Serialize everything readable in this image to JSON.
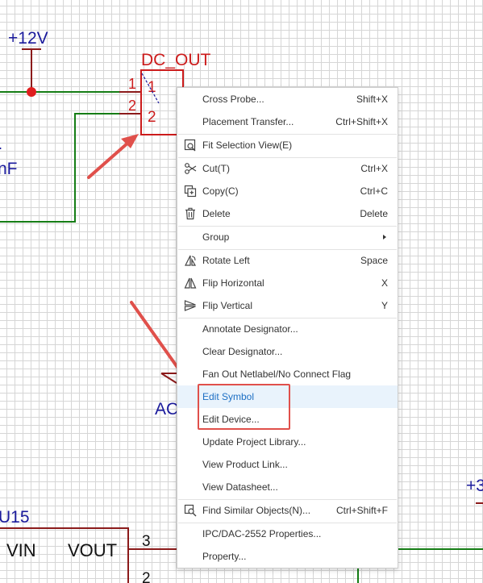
{
  "schematic": {
    "power_12v": "+12V",
    "power_3v": "+3",
    "connector_name": "DC_OUT",
    "connector_pin1": "1",
    "connector_pin2": "2",
    "pin_num_1": "1",
    "pin_num_2": "2",
    "cap_value": "nF",
    "cap_dot": ".",
    "net_label": "AC",
    "u15_name": "U15",
    "u15_vin": "VIN",
    "u15_vout": "VOUT",
    "u15_pin3": "3",
    "u15_pin2": "2"
  },
  "colors": {
    "wire": "#157d15",
    "symbol": "#cc1b1b",
    "net_text": "#1a1a9c",
    "junction": "#e01e1e",
    "annotation": "#e0504b",
    "component_body": "#8b1a1a"
  },
  "context_menu": {
    "items": [
      {
        "label": "Cross Probe...",
        "shortcut": "Shift+X",
        "icon": ""
      },
      {
        "label": "Placement Transfer...",
        "shortcut": "Ctrl+Shift+X",
        "icon": ""
      },
      {
        "label": "Fit Selection View(E)",
        "shortcut": "",
        "icon": "fit-view-icon"
      },
      {
        "label": "Cut(T)",
        "shortcut": "Ctrl+X",
        "icon": "scissors-icon"
      },
      {
        "label": "Copy(C)",
        "shortcut": "Ctrl+C",
        "icon": "copy-icon"
      },
      {
        "label": "Delete",
        "shortcut": "Delete",
        "icon": "trash-icon"
      },
      {
        "label": "Group",
        "shortcut": "",
        "icon": "",
        "submenu": true
      },
      {
        "label": "Rotate Left",
        "shortcut": "Space",
        "icon": "rotate-left-icon"
      },
      {
        "label": "Flip Horizontal",
        "shortcut": "X",
        "icon": "flip-horizontal-icon"
      },
      {
        "label": "Flip Vertical",
        "shortcut": "Y",
        "icon": "flip-vertical-icon"
      },
      {
        "label": "Annotate Designator...",
        "shortcut": "",
        "icon": ""
      },
      {
        "label": "Clear Designator...",
        "shortcut": "",
        "icon": ""
      },
      {
        "label": "Fan Out Netlabel/No Connect Flag",
        "shortcut": "",
        "icon": ""
      },
      {
        "label": "Edit Symbol",
        "shortcut": "",
        "icon": "",
        "highlighted": true
      },
      {
        "label": "Edit Device...",
        "shortcut": "",
        "icon": ""
      },
      {
        "label": "Update Project Library...",
        "shortcut": "",
        "icon": ""
      },
      {
        "label": "View Product Link...",
        "shortcut": "",
        "icon": ""
      },
      {
        "label": "View Datasheet...",
        "shortcut": "",
        "icon": ""
      },
      {
        "label": "Find Similar Objects(N)...",
        "shortcut": "Ctrl+Shift+F",
        "icon": "find-similar-icon"
      },
      {
        "label": "IPC/DAC-2552 Properties...",
        "shortcut": "",
        "icon": ""
      },
      {
        "label": "Property...",
        "shortcut": "",
        "icon": ""
      }
    ]
  }
}
